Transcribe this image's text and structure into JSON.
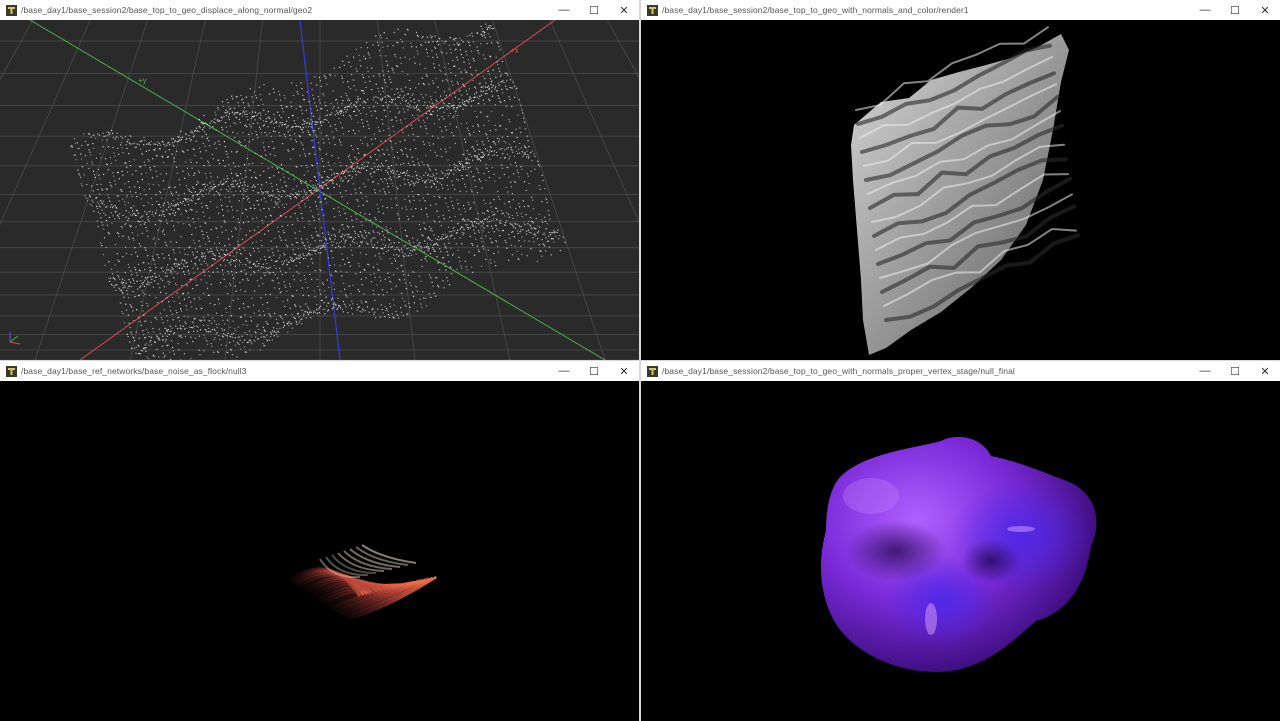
{
  "windows": [
    {
      "title": "/base_day1/base_session2/base_top_to_geo_displace_along_normal/geo2"
    },
    {
      "title": "/base_day1/base_session2/base_top_to_geo_with_normals_and_color/render1"
    },
    {
      "title": "/base_day1/base_ref_networks/base_noise_as_flock/null3"
    },
    {
      "title": "/base_day1/base_session2/base_top_to_geo_with_normals_proper_vertex_stage/null_final"
    }
  ],
  "controls": {
    "minimize_glyph": "—",
    "maximize_glyph": "☐",
    "close_glyph": "✕"
  },
  "viewport1": {
    "y_axis_label": "+y",
    "x_axis_label": "+x"
  },
  "icons": {
    "app": "touchdesigner-icon"
  },
  "colors": {
    "axis_x": "#d84a52",
    "axis_y": "#4cae4c",
    "axis_z": "#3a3ad8",
    "grid": "#4a4a4a",
    "viewport_bg": "#2c2c2c",
    "blob": "#7a2ad8",
    "flock": "#e8553a"
  }
}
